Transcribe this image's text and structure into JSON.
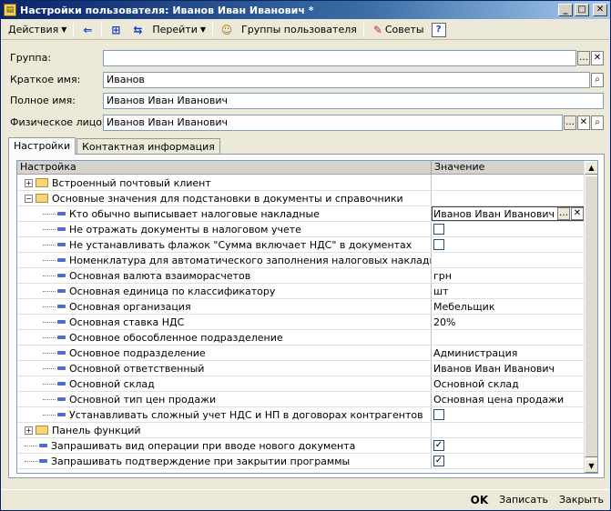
{
  "window": {
    "title": "Настройки пользователя: Иванов Иван Иванович *",
    "minimize": "_",
    "maximize": "□",
    "close": "✕"
  },
  "toolbar": {
    "actions": "Действия",
    "goto": "Перейти",
    "user_groups": "Группы пользователя",
    "tips": "Советы",
    "help": "?"
  },
  "form": {
    "group_label": "Группа:",
    "group_value": "",
    "short_name_label": "Краткое имя:",
    "short_name_value": "Иванов",
    "full_name_label": "Полное имя:",
    "full_name_value": "Иванов Иван Иванович",
    "person_label": "Физическое лицо:",
    "person_value": "Иванов Иван Иванович"
  },
  "tabs": [
    {
      "label": "Настройки",
      "active": true
    },
    {
      "label": "Контактная информация",
      "active": false
    }
  ],
  "grid": {
    "col_setting": "Настройка",
    "col_value": "Значение",
    "rows": [
      {
        "level": 0,
        "kind": "folder",
        "expander": "+",
        "label": "Встроенный почтовый клиент",
        "value": ""
      },
      {
        "level": 0,
        "kind": "folder",
        "expander": "−",
        "label": "Основные значения для подстановки в документы и справочники",
        "value": ""
      },
      {
        "level": 1,
        "kind": "leaf",
        "label": "Кто обычно выписывает налоговые накладные",
        "value": "Иванов Иван Иванович",
        "selected": true
      },
      {
        "level": 1,
        "kind": "leaf",
        "label": "Не отражать документы в налоговом учете",
        "value": "",
        "checkbox": false
      },
      {
        "level": 1,
        "kind": "leaf",
        "label": "Не устанавливать флажок \"Сумма включает НДС\" в документах",
        "value": "",
        "checkbox": false
      },
      {
        "level": 1,
        "kind": "leaf",
        "label": "Номенклатура для автоматического заполнения налоговых накладных",
        "value": ""
      },
      {
        "level": 1,
        "kind": "leaf",
        "label": "Основная валюта взаиморасчетов",
        "value": "грн"
      },
      {
        "level": 1,
        "kind": "leaf",
        "label": "Основная единица по классификатору",
        "value": "шт"
      },
      {
        "level": 1,
        "kind": "leaf",
        "label": "Основная организация",
        "value": "Мебельщик"
      },
      {
        "level": 1,
        "kind": "leaf",
        "label": "Основная ставка НДС",
        "value": "20%"
      },
      {
        "level": 1,
        "kind": "leaf",
        "label": "Основное обособленное подразделение",
        "value": ""
      },
      {
        "level": 1,
        "kind": "leaf",
        "label": "Основное подразделение",
        "value": "Администрация"
      },
      {
        "level": 1,
        "kind": "leaf",
        "label": "Основной ответственный",
        "value": "Иванов Иван Иванович"
      },
      {
        "level": 1,
        "kind": "leaf",
        "label": "Основной склад",
        "value": "Основной склад"
      },
      {
        "level": 1,
        "kind": "leaf",
        "label": "Основной тип цен продажи",
        "value": "Основная цена продажи"
      },
      {
        "level": 1,
        "kind": "leaf",
        "label": "Устанавливать сложный учет НДС и НП в договорах контрагентов",
        "value": "",
        "checkbox": false
      },
      {
        "level": 0,
        "kind": "folder",
        "expander": "+",
        "label": "Панель функций",
        "value": ""
      },
      {
        "level": 0,
        "kind": "leaf",
        "label": "Запрашивать вид операции при вводе нового документа",
        "value": "",
        "checkbox": true
      },
      {
        "level": 0,
        "kind": "leaf",
        "label": "Запрашивать подтверждение при закрытии программы",
        "value": "",
        "checkbox": true
      }
    ]
  },
  "bottom": {
    "ok": "OK",
    "save": "Записать",
    "close": "Закрыть"
  },
  "colors": {
    "title_start": "#0a246a",
    "title_end": "#a6caf0",
    "window_bg": "#ece9d8",
    "folder": "#f3d67a",
    "leaf_marker": "#4a6fd0"
  }
}
